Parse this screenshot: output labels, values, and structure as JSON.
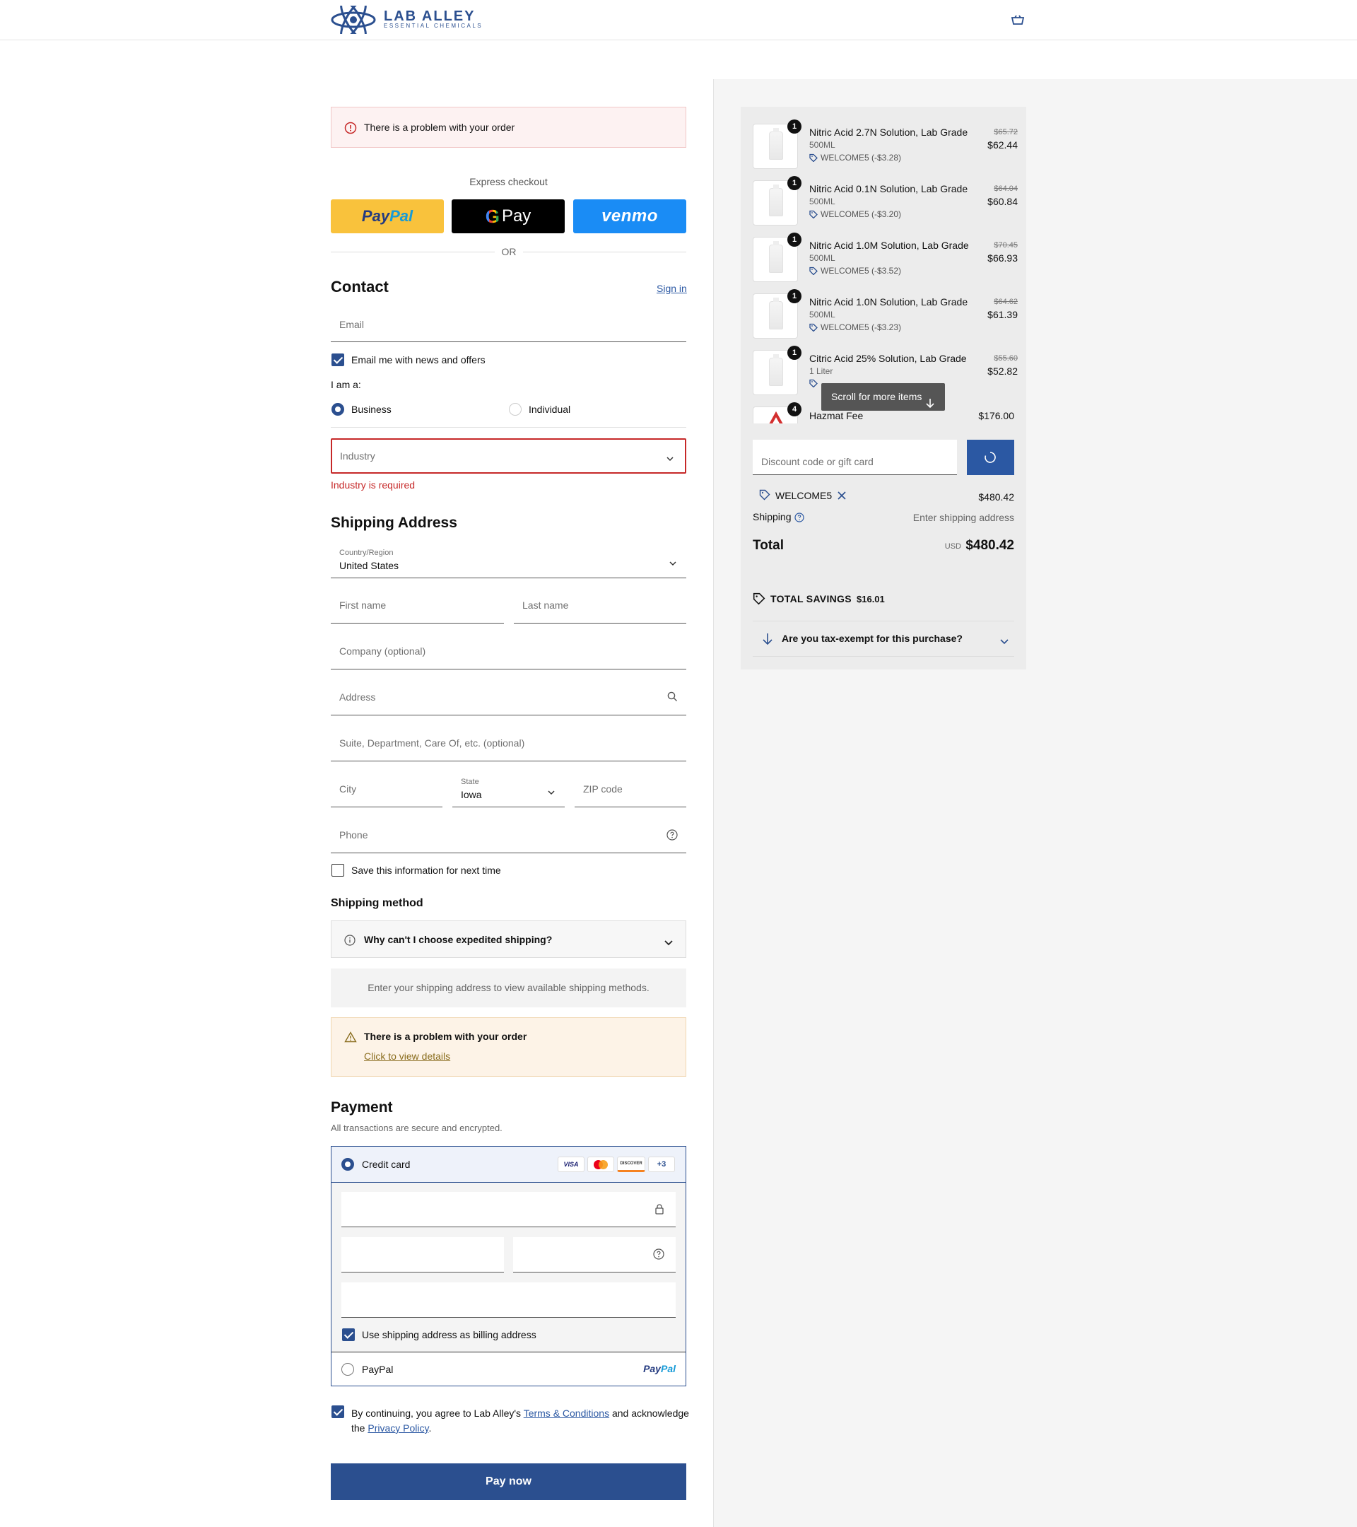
{
  "header": {
    "brand": "LAB ALLEY",
    "brand_sub": "ESSENTIAL CHEMICALS"
  },
  "alert_top": {
    "text": "There is a problem with your order"
  },
  "express": {
    "label": "Express checkout",
    "paypal_a": "Pay",
    "paypal_b": "Pal",
    "gpay": "Pay",
    "venmo": "venmo",
    "or": "OR"
  },
  "contact": {
    "title": "Contact",
    "sign_in": "Sign in",
    "email_placeholder": "Email",
    "news_label": "Email me with news and offers",
    "i_am": "I am a:",
    "business": "Business",
    "individual": "Individual",
    "industry_placeholder": "Industry",
    "industry_error": "Industry is required"
  },
  "shipping_address": {
    "title": "Shipping Address",
    "country_label": "Country/Region",
    "country_value": "United States",
    "first_name": "First name",
    "last_name": "Last name",
    "company": "Company (optional)",
    "address": "Address",
    "suite": "Suite, Department, Care Of, etc. (optional)",
    "city": "City",
    "state_label": "State",
    "state_value": "Iowa",
    "zip": "ZIP code",
    "phone": "Phone",
    "save_info": "Save this information for next time"
  },
  "shipping_method": {
    "title": "Shipping method",
    "why": "Why can't I choose expedited shipping?",
    "info": "Enter your shipping address to view available shipping methods.",
    "warn_title": "There is a problem with your order",
    "warn_link": "Click to view details"
  },
  "payment": {
    "title": "Payment",
    "subtitle": "All transactions are secure and encrypted.",
    "credit_card": "Credit card",
    "card_visa": "VISA",
    "card_discover": "DISCOVER",
    "card_more": "+3",
    "billing_same": "Use shipping address as billing address",
    "paypal": "PayPal",
    "paypal_logo_a": "Pay",
    "paypal_logo_b": "Pal"
  },
  "terms": {
    "pre": "By continuing, you agree to Lab Alley's ",
    "terms_link": "Terms & Conditions",
    "mid": " and acknowledge the ",
    "privacy_link": "Privacy Policy",
    "post": "."
  },
  "pay_now": "Pay now",
  "summary": {
    "items": [
      {
        "qty": "1",
        "name": "Nitric Acid 2.7N Solution, Lab Grade",
        "variant": "500ML",
        "discount": "WELCOME5 (-$3.28)",
        "old_price": "$65.72",
        "price": "$62.44"
      },
      {
        "qty": "1",
        "name": "Nitric Acid 0.1N Solution, Lab Grade",
        "variant": "500ML",
        "discount": "WELCOME5 (-$3.20)",
        "old_price": "$64.04",
        "price": "$60.84"
      },
      {
        "qty": "1",
        "name": "Nitric Acid 1.0M Solution, Lab Grade",
        "variant": "500ML",
        "discount": "WELCOME5 (-$3.52)",
        "old_price": "$70.45",
        "price": "$66.93"
      },
      {
        "qty": "1",
        "name": "Nitric Acid 1.0N Solution, Lab Grade",
        "variant": "500ML",
        "discount": "WELCOME5 (-$3.23)",
        "old_price": "$64.62",
        "price": "$61.39"
      },
      {
        "qty": "1",
        "name": "Citric Acid 25% Solution, Lab Grade",
        "variant": "1 Liter",
        "discount": "",
        "old_price": "$55.60",
        "price": "$52.82"
      }
    ],
    "hazmat": {
      "qty": "4",
      "name": "Hazmat Fee",
      "price": "$176.00"
    },
    "scroll_tip": "Scroll for more items",
    "discount_placeholder": "Discount code or gift card",
    "applied_code": "WELCOME5",
    "subtotal": "$480.42",
    "shipping_label": "Shipping",
    "shipping_value": "Enter shipping address",
    "total_label": "Total",
    "currency": "USD",
    "total": "$480.42",
    "savings_label": "TOTAL SAVINGS",
    "savings_value": "$16.01",
    "tax_exempt": "Are you tax-exempt for this purchase?"
  }
}
